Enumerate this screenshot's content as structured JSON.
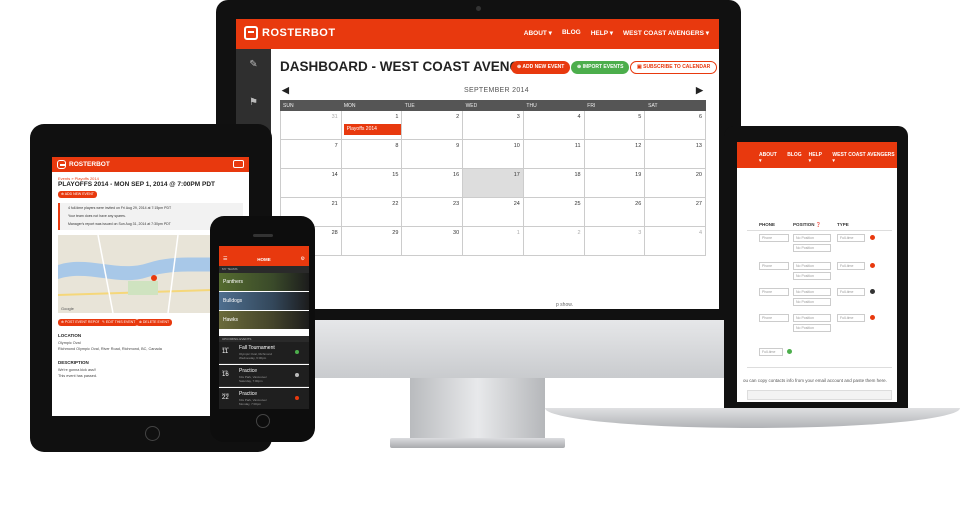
{
  "desktop": {
    "brand": "ROSTERBOT",
    "nav": [
      "ABOUT ▾",
      "BLOG",
      "HELP ▾",
      "WEST COAST AVENGERS ▾"
    ],
    "title": "DASHBOARD - WEST COAST AVENGERS",
    "buttons": {
      "add_event": "⊕ ADD NEW EVENT",
      "import_events": "⊕ IMPORT EVENTS",
      "subscribe": "▣ SUBSCRIBE TO CALENDAR"
    },
    "calendar": {
      "month": "SEPTEMBER 2014",
      "prev": "◀",
      "next": "▶",
      "weekdays": [
        "SUN",
        "MON",
        "TUE",
        "WED",
        "THU",
        "FRI",
        "SAT"
      ],
      "days": [
        {
          "d": "31",
          "muted": true
        },
        {
          "d": "1",
          "event": "Playoffs 2014"
        },
        {
          "d": "2"
        },
        {
          "d": "3"
        },
        {
          "d": "4"
        },
        {
          "d": "5"
        },
        {
          "d": "6"
        },
        {
          "d": "7"
        },
        {
          "d": "8"
        },
        {
          "d": "9"
        },
        {
          "d": "10"
        },
        {
          "d": "11"
        },
        {
          "d": "12"
        },
        {
          "d": "13"
        },
        {
          "d": "14"
        },
        {
          "d": "15"
        },
        {
          "d": "16"
        },
        {
          "d": "17",
          "today": true
        },
        {
          "d": "18"
        },
        {
          "d": "19"
        },
        {
          "d": "20"
        },
        {
          "d": "21"
        },
        {
          "d": "22"
        },
        {
          "d": "23"
        },
        {
          "d": "24"
        },
        {
          "d": "25"
        },
        {
          "d": "26"
        },
        {
          "d": "27"
        },
        {
          "d": "28"
        },
        {
          "d": "29"
        },
        {
          "d": "30"
        },
        {
          "d": "1",
          "muted": true
        },
        {
          "d": "2",
          "muted": true
        },
        {
          "d": "3",
          "muted": true
        },
        {
          "d": "4",
          "muted": true
        }
      ]
    },
    "peek_text": "p show."
  },
  "laptop": {
    "nav": [
      "ABOUT ▾",
      "BLOG",
      "HELP ▾",
      "WEST COAST AVENGERS ▾"
    ],
    "headers": [
      "PHONE",
      "POSITION ❓",
      "TYPE"
    ],
    "rows": [
      {
        "phone": "Phone",
        "pos1": "No Position",
        "pos2": "No Position",
        "type": "Full-time"
      },
      {
        "phone": "Phone",
        "pos1": "No Position",
        "pos2": "No Position",
        "type": "Full-time"
      },
      {
        "phone": "Phone",
        "pos1": "No Position",
        "pos2": "No Position",
        "type": "Full-time"
      },
      {
        "phone": "Phone",
        "pos1": "No Position",
        "pos2": "No Position",
        "type": "Full-time"
      }
    ],
    "extra_select": "Full-time",
    "copy_text": "ou can copy contacts info from your email account and paste them here."
  },
  "tablet": {
    "brand": "ROSTERBOT",
    "breadcrumb": "Events  »  Playoffs 2014",
    "title": "PLAYOFFS 2014 - MON SEP 1, 2014 @ 7:00PM PDT",
    "add_event": "⊕ ADD NEW EVENT",
    "alerts": [
      "4 full-time players were invited on Fri Aug 29, 2014 at 7:15pm PDT",
      "Your team does not have any spares.",
      "Manager's report was issued on Sun Aug 31, 2014 at 7:30pm PDT"
    ],
    "actions": [
      "⊕ POST EVENT REPORT",
      "✎ EDIT THIS EVENT",
      "⊗ DELETE EVENT"
    ],
    "location_label": "LOCATION",
    "location_lines": [
      "Olympic Oval",
      "Richmond Olympic Oval, River Road, Richmond, BC, Canada"
    ],
    "description_label": "DESCRIPTION",
    "description_lines": [
      "We're gonna kick ass!!",
      "This event has passed."
    ],
    "map_brand": "Google"
  },
  "phone": {
    "title": "HOME",
    "my_teams": "MY TEAMS",
    "teams": [
      "Panthers",
      "Bulldogs",
      "Hawks"
    ],
    "upcoming": "UPCOMING EVENTS",
    "events": [
      {
        "day": "WED",
        "date": "11",
        "name": "Fall Tournament",
        "loc1": "Olympic Oval, Richmond",
        "loc2": "Wednesday, 6:00pm",
        "status": "#4cae4c"
      },
      {
        "day": "SAT",
        "date": "16",
        "name": "Practice",
        "loc1": "Kits Park, Vancouver",
        "loc2": "Saturday, 7:00pm",
        "status": "#bbbbbb"
      },
      {
        "day": "MON",
        "date": "22",
        "name": "Practice",
        "loc1": "Kits Park, Vancouver",
        "loc2": "Monday, 7:00pm",
        "status": "#e8390e"
      }
    ]
  },
  "colors": {
    "accent": "#e8390e",
    "success": "#4cae4c",
    "sidebar": "#2f2f2f"
  }
}
